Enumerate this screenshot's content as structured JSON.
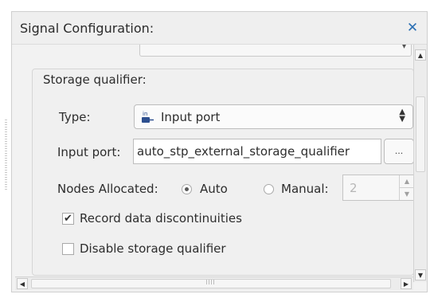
{
  "dialog": {
    "title": "Signal Configuration:",
    "close_icon": "close-icon"
  },
  "storage_qualifier": {
    "group_title": "Storage qualifier:",
    "type_label": "Type:",
    "type_value": "Input port",
    "type_icon": "input-port-icon",
    "input_port_label": "Input port:",
    "input_port_value": "auto_stp_external_storage_qualifier",
    "browse_label": "...",
    "nodes_allocated_label": "Nodes Allocated:",
    "auto_label": "Auto",
    "auto_selected": true,
    "manual_label": "Manual:",
    "manual_selected": false,
    "manual_value": "2",
    "record_discontinuities_label": "Record data discontinuities",
    "record_discontinuities_checked": true,
    "disable_label": "Disable storage qualifier",
    "disable_checked": false
  },
  "colors": {
    "close_icon": "#2b6fb3",
    "panel_bg": "#f2f2f2",
    "disabled_text": "#b7b7b7"
  }
}
